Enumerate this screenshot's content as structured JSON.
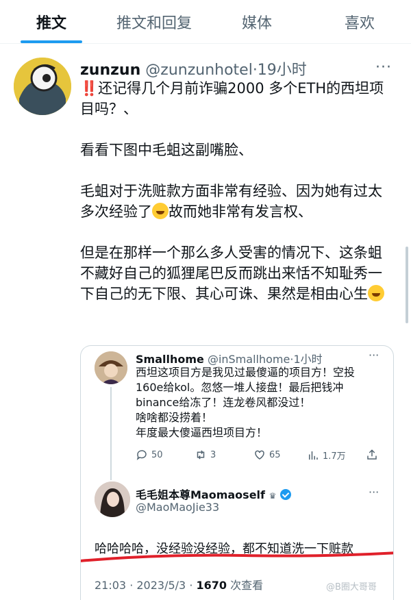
{
  "tabs": [
    {
      "label": "推文",
      "active": true
    },
    {
      "label": "推文和回复",
      "active": false
    },
    {
      "label": "媒体",
      "active": false
    },
    {
      "label": "喜欢",
      "active": false
    }
  ],
  "tweet": {
    "name": "zunzun",
    "handle": "@zunzunhotel",
    "time": "·19小时",
    "more": "···",
    "bang": "‼️",
    "p1": "还记得几个月前诈骗2000 多个ETH的西坦项目吗？、",
    "p2": "看看下图中毛蛆这副嘴脸、",
    "p3a": "毛蛆对于洗赃款方面非常有经验、因为她有过太多次经验了",
    "p3b": "故而她非常有发言权、",
    "p4": "但是在那样一个那么多人受害的情况下、这条蛆不藏好自己的狐狸尾巴反而跳出来恬不知耻秀一下自己的无下限、其心可诛、果然是相由心生"
  },
  "quote": {
    "name": "Smallhome",
    "handle": "@inSmallhome",
    "time": "·1小时",
    "more": "···",
    "lines": [
      "西坦这项目方是我见过最傻逼的项目方！空投",
      "160e给kol。忽悠一堆人接盘！最后把钱冲",
      "binance给冻了！连龙卷风都没过！",
      "啥啥都没捞着！",
      "年度最大傻逼西坦项目方！"
    ],
    "actions": {
      "reply": "50",
      "retweet": "3",
      "like": "65",
      "views": "1.7万"
    }
  },
  "reply": {
    "name": "毛毛姐本尊Maomaoself",
    "crown": "♛",
    "handle": "@MaoMaoJie33",
    "more": "···",
    "text": "哈哈哈哈，没经验没经验，都不知道洗一下赃款",
    "timestamp": "21:03 · 2023/5/3 · ",
    "views_count": "1670",
    "views_label": " 次查看"
  },
  "watermark": "@B圈大哥哥",
  "colors": {
    "accent": "#1d9bf0",
    "text": "#0f1419",
    "muted": "#536471",
    "underline": "#e0202a",
    "bang": "#e0245e"
  }
}
